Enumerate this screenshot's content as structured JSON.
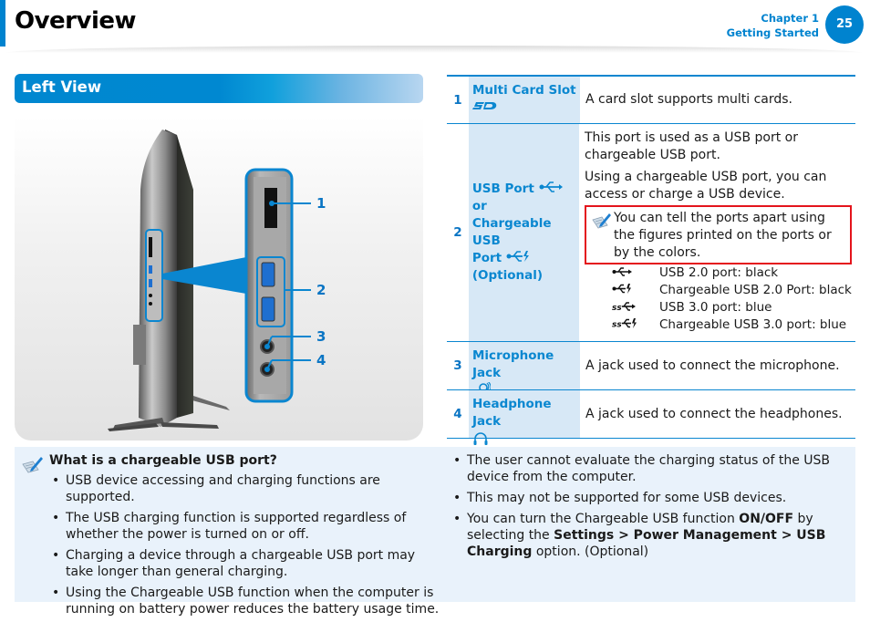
{
  "header": {
    "title": "Overview",
    "chapter": "Chapter 1",
    "chapter_title": "Getting Started",
    "page_number": "25"
  },
  "section": {
    "title": "Left View"
  },
  "figure": {
    "callouts": [
      "1",
      "2",
      "3",
      "4"
    ]
  },
  "table": {
    "rows": [
      {
        "number": "1",
        "name": "Multi Card Slot",
        "icon": "sd-card-icon",
        "description": "A card slot supports multi cards."
      },
      {
        "number": "2",
        "name_line1": "USB Port",
        "name_line2": "or",
        "name_line3": "Chargeable USB",
        "name_line4": "Port",
        "name_line5": "(Optional)",
        "description_p1": "This port is used as a USB port or chargeable USB port.",
        "description_p2": "Using a chargeable USB port, you can access or charge a USB device.",
        "note": "You can tell the ports apart using the figures printed on the ports or by the colors.",
        "legend": [
          {
            "icon": "usb-icon",
            "label": "USB 2.0 port: black"
          },
          {
            "icon": "chargeable-usb-icon",
            "label": "Chargeable USB 2.0 Port: black"
          },
          {
            "icon": "usb3-ss-icon",
            "label": "USB 3.0 port: blue"
          },
          {
            "icon": "chargeable-usb3-ss-icon",
            "label": "Chargeable USB 3.0 port: blue"
          }
        ]
      },
      {
        "number": "3",
        "name": "Microphone Jack",
        "icon": "microphone-icon",
        "description": "A jack used to connect the microphone."
      },
      {
        "number": "4",
        "name": "Headphone Jack",
        "icon": "headphone-icon",
        "description": "A jack used to connect the headphones."
      }
    ]
  },
  "info_box": {
    "title": "What is a chargeable USB port?",
    "left_items": [
      "USB device accessing and charging functions are supported.",
      "The USB charging function is supported regardless of whether the power is turned on or off.",
      "Charging a device through a chargeable USB port may take longer than general charging.",
      "Using the Chargeable USB function when the computer is running on battery power reduces the battery usage time."
    ],
    "right_items": [
      "The user cannot evaluate the charging status of the USB device from the computer.",
      "This may not be supported for some USB devices."
    ],
    "right_item3": {
      "pre": "You can turn the Chargeable USB function ",
      "bold1": "ON/OFF",
      "mid": " by selecting the ",
      "bold2": "Settings > Power Management > USB Charging",
      "post": " option. (Optional)"
    }
  },
  "colors": {
    "accent": "#0083cf",
    "table_name_bg": "#d7e8f6",
    "highlight_border": "#e4141c",
    "info_bg": "#e9f2fb"
  }
}
